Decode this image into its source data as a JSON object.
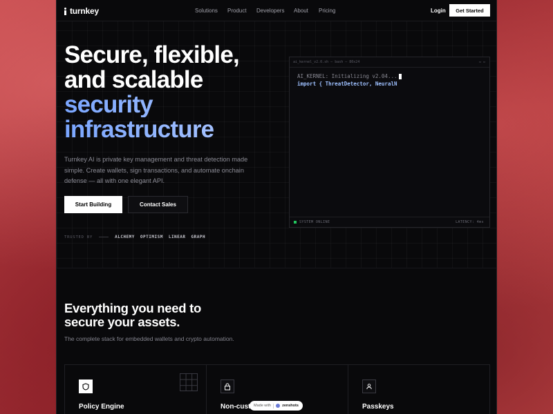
{
  "nav": {
    "brand": "turnkey",
    "links": [
      "Solutions",
      "Product",
      "Developers",
      "About",
      "Pricing"
    ],
    "login": "Login",
    "cta": "Get Started"
  },
  "hero": {
    "title_lines": [
      "Secure, flexible,",
      "and scalable"
    ],
    "title_accent_lines": [
      "security",
      "infrastructure"
    ],
    "description": "Turnkey AI is private key management and threat detection made simple. Create wallets, sign transactions, and automate onchain defense — all with one elegant API.",
    "primary_button": "Start Building",
    "secondary_button": "Contact Sales",
    "trusted_label": "TRUSTED BY",
    "trusted_logos": [
      "ALCHEMY",
      "OPTIMISM",
      "LINEAR",
      "GRAPH"
    ]
  },
  "terminal": {
    "title": "ai_kernel_v2.0.sh — bash — 80x24",
    "controls": "▭ ▭",
    "line1": "AI_KERNEL: Initializing v2.04...",
    "line2": "import { ThreatDetector, NeuralN",
    "status": "SYSTEM ONLINE",
    "latency": "LATENCY: 4ms",
    "status_color": "#22c55e"
  },
  "features": {
    "title": "Everything you need to secure your assets.",
    "subtitle": "The complete stack for embedded wallets and crypto automation.",
    "cards": [
      {
        "title": "Policy Engine",
        "icon": "shield-icon"
      },
      {
        "title": "Non-custo",
        "icon": "lock-icon"
      },
      {
        "title": "Passkeys",
        "icon": "user-icon"
      }
    ]
  },
  "badge": {
    "prefix": "Made with",
    "brand": "zenshots"
  },
  "colors": {
    "background": "#09090b",
    "accent_gradient_start": "#7aa6ff",
    "accent_gradient_end": "#b3cbff"
  }
}
